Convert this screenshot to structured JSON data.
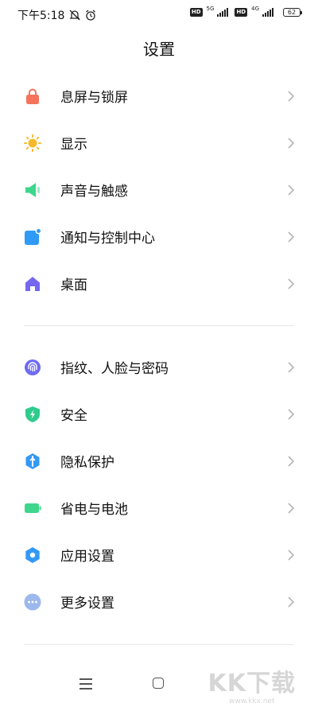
{
  "status_bar": {
    "time": "下午5:18",
    "network_1": "5G",
    "network_2": "4G",
    "battery": "62",
    "hd_label": "HD",
    "icons": [
      "mute-icon",
      "alarm-icon",
      "hd-icon",
      "signal-icon",
      "battery-icon"
    ]
  },
  "header": {
    "title": "设置"
  },
  "groups": [
    {
      "items": [
        {
          "label": "息屏与锁屏",
          "icon": "lock-icon",
          "color": "#F5735A"
        },
        {
          "label": "显示",
          "icon": "sun-icon",
          "color": "#F7B92B"
        },
        {
          "label": "声音与触感",
          "icon": "speaker-icon",
          "color": "#3DD68C"
        },
        {
          "label": "通知与控制中心",
          "icon": "notification-icon",
          "color": "#2F9BF6"
        },
        {
          "label": "桌面",
          "icon": "home-icon",
          "color": "#7468F0"
        }
      ]
    },
    {
      "items": [
        {
          "label": "指纹、人脸与密码",
          "icon": "fingerprint-icon",
          "color": "#6E6CF2"
        },
        {
          "label": "安全",
          "icon": "shield-icon",
          "color": "#2FCB8C"
        },
        {
          "label": "隐私保护",
          "icon": "privacy-icon",
          "color": "#3399F5"
        },
        {
          "label": "省电与电池",
          "icon": "battery-saver-icon",
          "color": "#3DD68C"
        },
        {
          "label": "应用设置",
          "icon": "gear-icon",
          "color": "#3399F5"
        },
        {
          "label": "更多设置",
          "icon": "more-icon",
          "color": "#9DB8EC"
        }
      ]
    }
  ],
  "watermark": {
    "big": "KK下载",
    "small": "www.kkx.net"
  }
}
